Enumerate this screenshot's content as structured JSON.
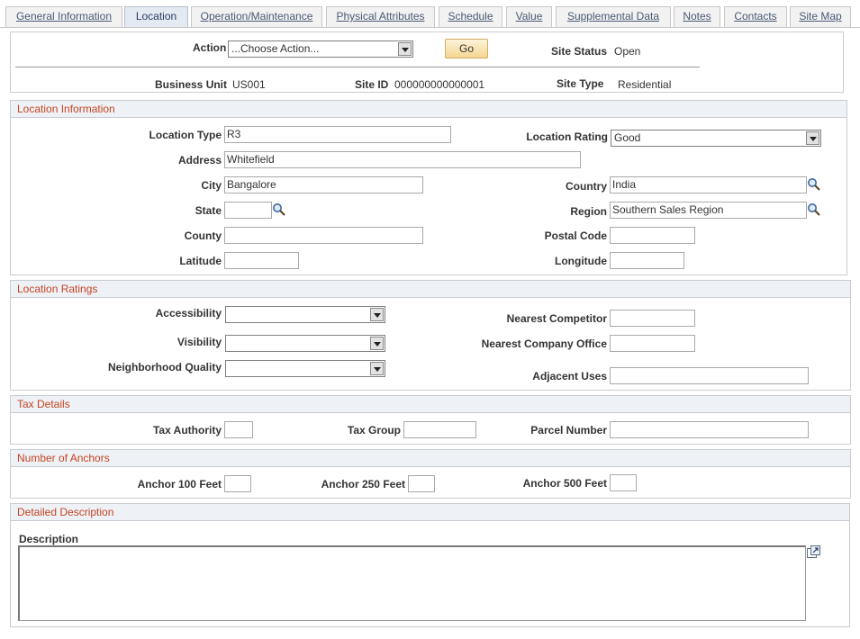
{
  "tabs": [
    {
      "label": "General Information"
    },
    {
      "label": "Location"
    },
    {
      "label": "Operation/Maintenance"
    },
    {
      "label": "Physical Attributes"
    },
    {
      "label": "Schedule"
    },
    {
      "label": "Value"
    },
    {
      "label": "Supplemental Data"
    },
    {
      "label": "Notes"
    },
    {
      "label": "Contacts"
    },
    {
      "label": "Site Map"
    }
  ],
  "header": {
    "action_label": "Action",
    "action_value": "...Choose Action...",
    "go_label": "Go",
    "site_status_label": "Site Status",
    "site_status_value": "Open",
    "business_unit_label": "Business Unit",
    "business_unit_value": "US001",
    "site_id_label": "Site ID",
    "site_id_value": "000000000000001",
    "site_type_label": "Site Type",
    "site_type_value": "Residential"
  },
  "location_info": {
    "title": "Location Information",
    "location_type_label": "Location Type",
    "location_type_value": "R3",
    "location_rating_label": "Location Rating",
    "location_rating_value": "Good",
    "address_label": "Address",
    "address_value": "Whitefield",
    "city_label": "City",
    "city_value": "Bangalore",
    "country_label": "Country",
    "country_value": "India",
    "state_label": "State",
    "state_value": "",
    "region_label": "Region",
    "region_value": "Southern Sales Region",
    "county_label": "County",
    "county_value": "",
    "postal_label": "Postal Code",
    "postal_value": "",
    "latitude_label": "Latitude",
    "latitude_value": "",
    "longitude_label": "Longitude",
    "longitude_value": ""
  },
  "location_ratings": {
    "title": "Location Ratings",
    "accessibility_label": "Accessibility",
    "accessibility_value": "",
    "visibility_label": "Visibility",
    "visibility_value": "",
    "neighborhood_label": "Neighborhood Quality",
    "neighborhood_value": "",
    "nearest_competitor_label": "Nearest Competitor",
    "nearest_competitor_value": "",
    "nearest_office_label": "Nearest Company Office",
    "nearest_office_value": "",
    "adjacent_uses_label": "Adjacent Uses",
    "adjacent_uses_value": ""
  },
  "tax": {
    "title": "Tax Details",
    "authority_label": "Tax Authority",
    "authority_value": "",
    "group_label": "Tax Group",
    "group_value": "",
    "parcel_label": "Parcel Number",
    "parcel_value": ""
  },
  "anchors": {
    "title": "Number of Anchors",
    "a100_label": "Anchor 100 Feet",
    "a100_value": "",
    "a250_label": "Anchor 250 Feet",
    "a250_value": "",
    "a500_label": "Anchor 500 Feet",
    "a500_value": ""
  },
  "description": {
    "title": "Detailed Description",
    "label": "Description",
    "value": ""
  },
  "icons": {
    "lookup": "magnifier-icon",
    "expand": "expand-textarea-icon",
    "dropdown": "dropdown-arrow-icon"
  },
  "colors": {
    "section_title": "#c44422",
    "tab_text": "#4a5a74",
    "go_button": "#f4d692"
  }
}
